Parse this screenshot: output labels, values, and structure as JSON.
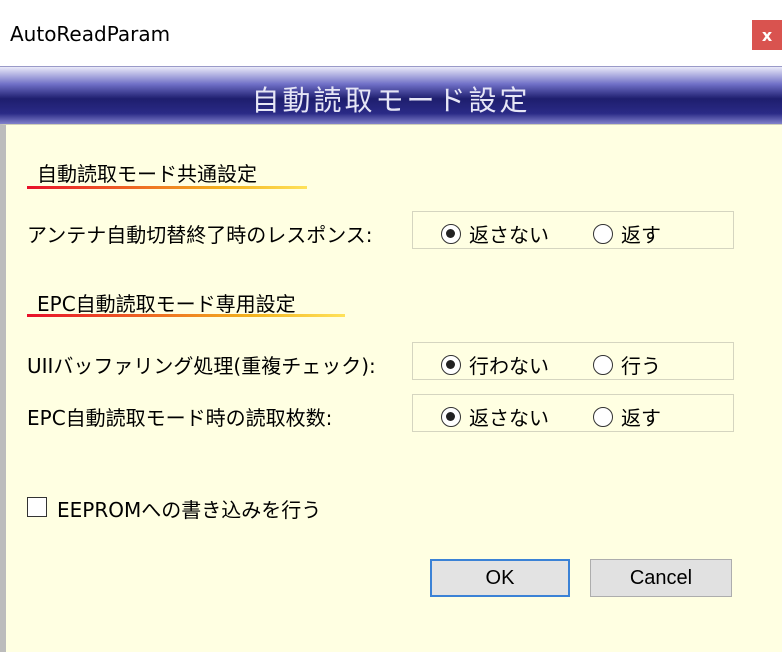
{
  "window": {
    "title": "AutoReadParam",
    "close_label": "x"
  },
  "banner": {
    "title": "自動読取モード設定"
  },
  "section_common": {
    "title": "自動読取モード共通設定"
  },
  "section_epc": {
    "title": "EPC自動読取モード専用設定"
  },
  "rows": [
    {
      "label": "アンテナ自動切替終了時のレスポンス:",
      "opt1": "返さない",
      "opt2": "返す",
      "selected": "opt1"
    },
    {
      "label": "UIIバッファリング処理(重複チェック):",
      "opt1": "行わない",
      "opt2": "行う",
      "selected": "opt1"
    },
    {
      "label": "EPC自動読取モード時の読取枚数:",
      "opt1": "返さない",
      "opt2": "返す",
      "selected": "opt1"
    }
  ],
  "eeprom": {
    "label": "EEPROMへの書き込みを行う",
    "checked": false
  },
  "buttons": {
    "ok": "OK",
    "cancel": "Cancel"
  },
  "colors": {
    "banner": "#1e1e6e",
    "content_bg": "#ffffe2",
    "close": "#d9534f",
    "ok_border": "#3b82d6"
  }
}
